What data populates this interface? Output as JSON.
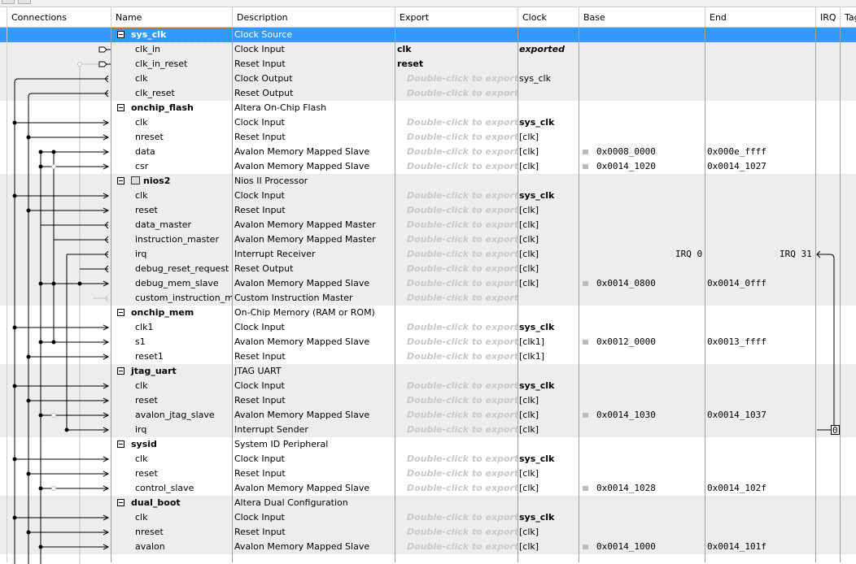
{
  "columns": [
    "Connections",
    "Name",
    "Description",
    "Export",
    "Clock",
    "Base",
    "End",
    "IRQ",
    "Tag"
  ],
  "placeholder_export": "Double-click to export",
  "irq_range": {
    "start": "IRQ 0",
    "end": "IRQ 31",
    "jtag_irq": "0"
  },
  "colors": {
    "selection": "#3399ff",
    "group_gray": "#ededed",
    "placeholder": "#c8c8c8"
  },
  "rows": [
    {
      "t": "h",
      "name": "sys_clk",
      "desc": "Clock Source",
      "sel": true
    },
    {
      "name": "clk_in",
      "desc": "Clock Input",
      "exp": "clk",
      "clk": "exported",
      "clkStyle": "bi"
    },
    {
      "name": "clk_in_reset",
      "desc": "Reset Input",
      "exp": "reset"
    },
    {
      "name": "clk",
      "desc": "Clock Output",
      "clk": "sys_clk",
      "clkStyle": ""
    },
    {
      "name": "clk_reset",
      "desc": "Reset Output"
    },
    {
      "t": "h",
      "name": "onchip_flash",
      "desc": "Altera On-Chip Flash"
    },
    {
      "name": "clk",
      "desc": "Clock Input",
      "clk": "sys_clk",
      "clkStyle": "bold"
    },
    {
      "name": "nreset",
      "desc": "Reset Input",
      "clk": "[clk]"
    },
    {
      "name": "data",
      "desc": "Avalon Memory Mapped Slave",
      "clk": "[clk]",
      "base": "0x0008_0000",
      "end": "0x000e_ffff"
    },
    {
      "name": "csr",
      "desc": "Avalon Memory Mapped Slave",
      "clk": "[clk]",
      "base": "0x0014_1020",
      "end": "0x0014_1027"
    },
    {
      "t": "h",
      "name": "nios2",
      "desc": "Nios II Processor",
      "cpu": true
    },
    {
      "name": "clk",
      "desc": "Clock Input",
      "clk": "sys_clk",
      "clkStyle": "bold"
    },
    {
      "name": "reset",
      "desc": "Reset Input",
      "clk": "[clk]"
    },
    {
      "name": "data_master",
      "desc": "Avalon Memory Mapped Master",
      "clk": "[clk]"
    },
    {
      "name": "instruction_master",
      "desc": "Avalon Memory Mapped Master",
      "clk": "[clk]"
    },
    {
      "name": "irq",
      "desc": "Interrupt Receiver",
      "clk": "[clk]",
      "irq": true
    },
    {
      "name": "debug_reset_request",
      "desc": "Reset Output",
      "clk": "[clk]"
    },
    {
      "name": "debug_mem_slave",
      "desc": "Avalon Memory Mapped Slave",
      "clk": "[clk]",
      "base": "0x0014_0800",
      "end": "0x0014_0fff"
    },
    {
      "name": "custom_instruction_m...",
      "desc": "Custom Instruction Master"
    },
    {
      "t": "h",
      "name": "onchip_mem",
      "desc": "On-Chip Memory (RAM or ROM)"
    },
    {
      "name": "clk1",
      "desc": "Clock Input",
      "clk": "sys_clk",
      "clkStyle": "bold"
    },
    {
      "name": "s1",
      "desc": "Avalon Memory Mapped Slave",
      "clk": "[clk1]",
      "base": "0x0012_0000",
      "end": "0x0013_ffff"
    },
    {
      "name": "reset1",
      "desc": "Reset Input",
      "clk": "[clk1]"
    },
    {
      "t": "h",
      "name": "jtag_uart",
      "desc": "JTAG UART"
    },
    {
      "name": "clk",
      "desc": "Clock Input",
      "clk": "sys_clk",
      "clkStyle": "bold"
    },
    {
      "name": "reset",
      "desc": "Reset Input",
      "clk": "[clk]"
    },
    {
      "name": "avalon_jtag_slave",
      "desc": "Avalon Memory Mapped Slave",
      "clk": "[clk]",
      "base": "0x0014_1030",
      "end": "0x0014_1037"
    },
    {
      "name": "irq",
      "desc": "Interrupt Sender",
      "clk": "[clk]",
      "irqsend": true
    },
    {
      "t": "h",
      "name": "sysid",
      "desc": "System ID Peripheral"
    },
    {
      "name": "clk",
      "desc": "Clock Input",
      "clk": "sys_clk",
      "clkStyle": "bold"
    },
    {
      "name": "reset",
      "desc": "Reset Input",
      "clk": "[clk]"
    },
    {
      "name": "control_slave",
      "desc": "Avalon Memory Mapped Slave",
      "clk": "[clk]",
      "base": "0x0014_1028",
      "end": "0x0014_102f"
    },
    {
      "t": "h",
      "name": "dual_boot",
      "desc": "Altera Dual Configuration"
    },
    {
      "name": "clk",
      "desc": "Clock Input",
      "clk": "sys_clk",
      "clkStyle": "bold"
    },
    {
      "name": "nreset",
      "desc": "Reset Input",
      "clk": "[clk]"
    },
    {
      "name": "avalon",
      "desc": "Avalon Memory Mapped Slave",
      "clk": "[clk]",
      "base": "0x0014_1000",
      "end": "0x0014_101f"
    }
  ]
}
